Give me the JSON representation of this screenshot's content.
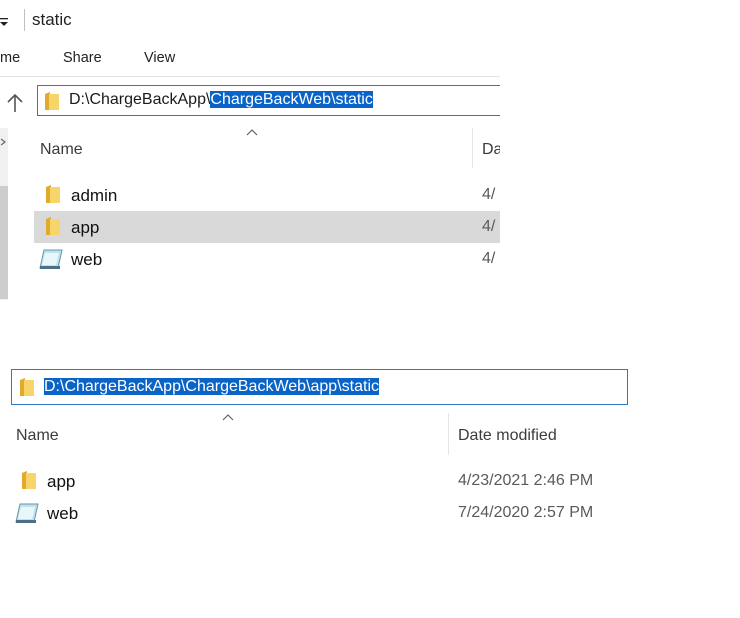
{
  "top": {
    "title": "static",
    "ribbon": {
      "home_partial": "me",
      "share": "Share",
      "view": "View"
    },
    "address": {
      "prefix": "D:\\ChargeBackApp\\",
      "selected": "ChargeBackWeb\\static"
    },
    "columns": {
      "name": "Name",
      "date_partial": "Da"
    },
    "rows": [
      {
        "name": "admin",
        "date_partial": "4/",
        "icon": "folder-icon",
        "selected": false
      },
      {
        "name": "app",
        "date_partial": "4/",
        "icon": "folder-icon",
        "selected": true
      },
      {
        "name": "web",
        "date_partial": "4/",
        "icon": "web-folder-icon",
        "selected": false
      }
    ]
  },
  "bottom": {
    "address": {
      "selected": "D:\\ChargeBackApp\\ChargeBackWeb\\app\\static"
    },
    "columns": {
      "name": "Name",
      "date": "Date modified"
    },
    "rows": [
      {
        "name": "app",
        "date": "4/23/2021 2:46 PM",
        "icon": "folder-icon"
      },
      {
        "name": "web",
        "date": "7/24/2020 2:57 PM",
        "icon": "web-folder-icon"
      }
    ]
  },
  "colors": {
    "selection": "#0a64c8",
    "address_border": "#2f78c8",
    "row_highlight": "#d9d9d9",
    "folder": "#f4c542"
  }
}
